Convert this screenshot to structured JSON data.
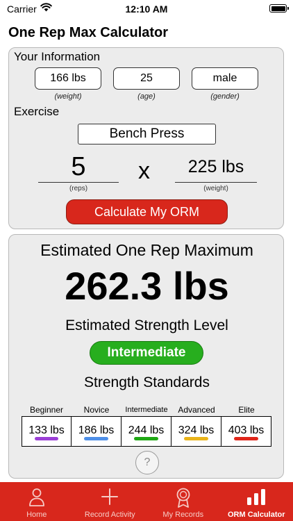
{
  "status_bar": {
    "carrier": "Carrier",
    "time": "12:10 AM"
  },
  "app_title": "One Rep Max Calculator",
  "info": {
    "heading": "Your Information",
    "weight": {
      "value": "166 lbs",
      "caption": "(weight)"
    },
    "age": {
      "value": "25",
      "caption": "(age)"
    },
    "gender": {
      "value": "male",
      "caption": "(gender)"
    },
    "exercise_heading": "Exercise",
    "exercise_value": "Bench Press",
    "reps": {
      "value": "5",
      "caption": "(reps)"
    },
    "times_sign": "x",
    "lift_weight": {
      "value": "225 lbs",
      "caption": "(weight)"
    },
    "calculate_label": "Calculate My ORM"
  },
  "result": {
    "orm_heading": "Estimated One Rep Maximum",
    "orm_value": "262.3 lbs",
    "level_heading": "Estimated Strength Level",
    "level_value": "Intermediate",
    "standards_heading": "Strength Standards",
    "standards": [
      {
        "label": "Beginner",
        "value": "133 lbs",
        "color": "#9b3fd6"
      },
      {
        "label": "Novice",
        "value": "186 lbs",
        "color": "#4e8fe8"
      },
      {
        "label": "Intermediate",
        "value": "244 lbs",
        "color": "#1fa814"
      },
      {
        "label": "Advanced",
        "value": "324 lbs",
        "color": "#eab41a"
      },
      {
        "label": "Elite",
        "value": "403 lbs",
        "color": "#e0261a"
      }
    ],
    "help_label": "?"
  },
  "tab_bar": {
    "items": [
      {
        "label": "Home",
        "icon": "person-icon"
      },
      {
        "label": "Record Activity",
        "icon": "plus-icon"
      },
      {
        "label": "My Records",
        "icon": "medal-icon"
      },
      {
        "label": "ORM Calculator",
        "icon": "bar-chart-icon"
      }
    ],
    "active_index": 3
  },
  "colors": {
    "accent_red": "#d8271c",
    "level_green": "#27ae1e",
    "card_background": "#ececec"
  }
}
